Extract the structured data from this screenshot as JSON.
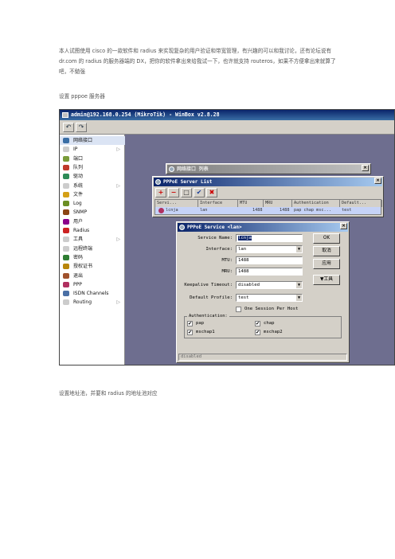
{
  "intro": "本人试图使用 cisco 的一款软件和 radius 来实现复杂的用户验证和带宽管理，有兴趣的可以和我讨论，还有论坛说有 dr.com 的 radius 的服务器端的 DX，把你的软件拿出来给我试一下，也许就支持 routeros，如果不方便拿出来就算了吧，不勉强",
  "caption_top": "设置 pppoe 服务器",
  "caption_bottom": "设置地址池，并要和 radius 的地址池对应",
  "winbox": {
    "title": "admin@192.168.0.254 (MikroTik) - WinBox v2.8.28",
    "toolbar": {
      "undo_icon": "undo-icon",
      "redo_icon": "redo-icon"
    },
    "sidebar": [
      {
        "label": "网络接口",
        "icon": "interfaces-icon",
        "color": "#3a6ea5",
        "submenu": false
      },
      {
        "label": "IP",
        "icon": "ip-icon",
        "color": "#cccccc",
        "submenu": true
      },
      {
        "label": "端口",
        "icon": "ports-icon",
        "color": "#7a9c3a",
        "submenu": false
      },
      {
        "label": "队列",
        "icon": "queues-icon",
        "color": "#c0392b",
        "submenu": false
      },
      {
        "label": "驱动",
        "icon": "drivers-icon",
        "color": "#2e8b57",
        "submenu": false
      },
      {
        "label": "系统",
        "icon": "system-icon",
        "color": "#cccccc",
        "submenu": true
      },
      {
        "label": "文件",
        "icon": "files-icon",
        "color": "#d4a017",
        "submenu": false
      },
      {
        "label": "Log",
        "icon": "log-icon",
        "color": "#6b8e23",
        "submenu": false
      },
      {
        "label": "SNMP",
        "icon": "snmp-icon",
        "color": "#8b4513",
        "submenu": false
      },
      {
        "label": "用户",
        "icon": "users-icon",
        "color": "#8b008b",
        "submenu": false
      },
      {
        "label": "Radius",
        "icon": "radius-icon",
        "color": "#cc2222",
        "submenu": false
      },
      {
        "label": "工具",
        "icon": "tools-icon",
        "color": "#cccccc",
        "submenu": true
      },
      {
        "label": "远程终端",
        "icon": "terminal-icon",
        "color": "#cccccc",
        "submenu": false
      },
      {
        "label": "密码",
        "icon": "password-icon",
        "color": "#2e7d32",
        "submenu": false
      },
      {
        "label": "授权证书",
        "icon": "license-icon",
        "color": "#b8860b",
        "submenu": false
      },
      {
        "label": "退出",
        "icon": "exit-icon",
        "color": "#a0522d",
        "submenu": false
      },
      {
        "label": "PPP",
        "icon": "ppp-icon",
        "color": "#b03060",
        "submenu": false
      },
      {
        "label": "ISDN Channels",
        "icon": "isdn-icon",
        "color": "#4a6fa5",
        "submenu": false
      },
      {
        "label": "Routing",
        "icon": "routing-icon",
        "color": "#cccccc",
        "submenu": true
      }
    ],
    "iface_window": {
      "title": "网络接口 列表"
    },
    "server_list": {
      "title": "PPPoE Server List",
      "tools": [
        "+",
        "−",
        "□",
        "✔",
        "✖"
      ],
      "columns": [
        "Servi...",
        "Interface",
        "MTU",
        "MRU",
        "Authentication",
        "Default..."
      ],
      "rows": [
        {
          "service": "lcnja",
          "interface": "lan",
          "mtu": "1488",
          "mru": "1488",
          "authentication": "pap chap msc...",
          "default_profile": "test"
        }
      ]
    },
    "service_dialog": {
      "title": "PPPoE Service <lan>",
      "fields": {
        "service_name_label": "Service Name:",
        "service_name": "lcnja",
        "interface_label": "Interface:",
        "interface": "lan",
        "mtu_label": "MTU:",
        "mtu": "1488",
        "mru_label": "MRU:",
        "mru": "1488",
        "keepalive_label": "Keepalive Timeout:",
        "keepalive": "disabled",
        "profile_label": "Default Profile:",
        "profile": "test",
        "one_session_label": "One Session Per Host"
      },
      "buttons": {
        "ok": "OK",
        "cancel": "取消",
        "apply": "应用",
        "tools": "▼工具"
      },
      "auth_group_label": "Authentication:",
      "auth": [
        {
          "label": "pap",
          "checked": true
        },
        {
          "label": "chap",
          "checked": true
        },
        {
          "label": "mschap1",
          "checked": true
        },
        {
          "label": "mschap2",
          "checked": true
        }
      ],
      "status": "disabled"
    }
  }
}
